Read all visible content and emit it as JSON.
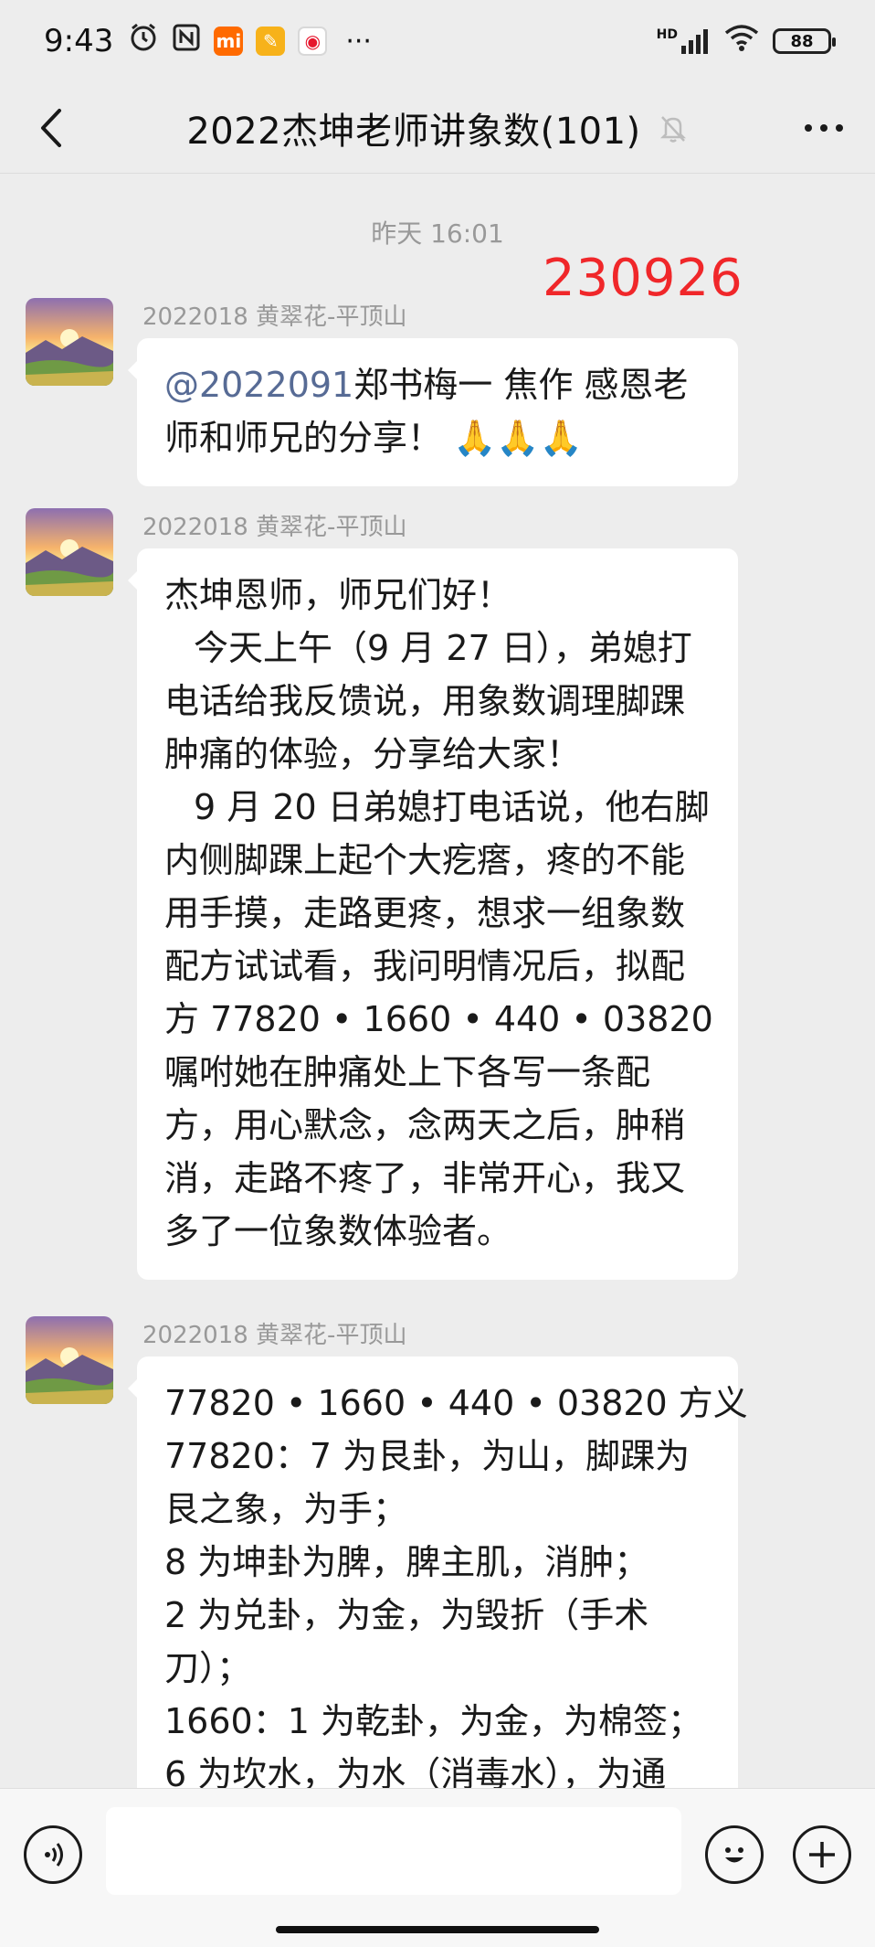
{
  "status_bar": {
    "time": "9:43",
    "battery": "88",
    "network": "HD",
    "more": "···"
  },
  "nav": {
    "title": "2022杰坤老师讲象数(101)"
  },
  "chat": {
    "timestamp": "昨天 16:01",
    "annotation": "230926",
    "messages": [
      {
        "sender": "2022018 黄翠花-平顶山",
        "mention": "@2022091",
        "lines": [
          "郑书梅一  焦作   感恩老",
          "师和师兄的分享！ 🙏🙏🙏"
        ]
      },
      {
        "sender": "2022018 黄翠花-平顶山",
        "lines": [
          "杰坤恩师，师兄们好！",
          "今天上午（9 月 27 日），弟媳打",
          "电话给我反馈说，用象数调理脚踝",
          "肿痛的体验，分享给大家！",
          "9 月 20 日弟媳打电话说，他右脚",
          "内侧脚踝上起个大疙瘩，疼的不能",
          "用手摸，走路更疼，想求一组象数",
          "配方试试看，我问明情况后，拟配",
          "方 77820 • 1660 • 440 • 03820",
          "嘱咐她在肿痛处上下各写一条配",
          "方，用心默念，念两天之后，肿稍",
          "消，走路不疼了，非常开心，我又",
          "多了一位象数体验者。"
        ]
      },
      {
        "sender": "2022018 黄翠花-平顶山",
        "lines": [
          "77820 • 1660 • 440 • 03820 方义",
          "77820：7 为艮卦，为山，脚踝为",
          "艮之象，为手；",
          "8 为坤卦为脾，脾主肌，消肿；",
          "2 为兑卦，为金，为毁折（手术",
          "刀）；",
          "1660：1 为乾卦，为金，为棉签；",
          "6 为坎水，为水（消毒水），为通"
        ]
      }
    ]
  },
  "colors": {
    "background": "#ededed",
    "bubble": "#ffffff",
    "mention": "#576b95",
    "annotation": "#f0272a"
  }
}
